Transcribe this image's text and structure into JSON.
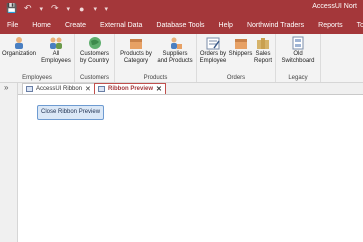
{
  "qat": {
    "save": "💾",
    "undo": "↶",
    "undo_caret": "▾",
    "redo": "↷",
    "redo_caret": "▾",
    "tool": "●",
    "tool_caret": "▾",
    "customize": "▾"
  },
  "app_title": "AccessUI Nort",
  "menu": [
    "File",
    "Home",
    "Create",
    "External Data",
    "Database Tools",
    "Help",
    "Northwind Traders",
    "Reports",
    "Tools"
  ],
  "ribbon": {
    "groups": {
      "employees": {
        "label": "Employees",
        "buttons": [
          "Organization",
          "All\nEmployees"
        ]
      },
      "customers": {
        "label": "Customers",
        "buttons": [
          "Customers\nby Country"
        ]
      },
      "products": {
        "label": "Products",
        "buttons": [
          "Products by\nCategory",
          "Suppliers\nand Products"
        ]
      },
      "orders": {
        "label": "Orders",
        "buttons": [
          "Orders by\nEmployee",
          "Shippers",
          "Sales\nReport"
        ]
      },
      "legacy": {
        "label": "Legacy",
        "buttons": [
          "Old\nSwitchboard"
        ]
      }
    }
  },
  "nav": {
    "toggle": "»"
  },
  "tabs": [
    {
      "label": "AccessUI Ribbon",
      "close": "✕"
    },
    {
      "label": "Ribbon Preview",
      "close": "✕"
    }
  ],
  "content": {
    "close_button": "Close Ribbon Preview"
  },
  "colors": {
    "accent": "#a4373a",
    "ribbon_bg": "#f3f3f3",
    "button_bg": "#dbe8f7"
  }
}
